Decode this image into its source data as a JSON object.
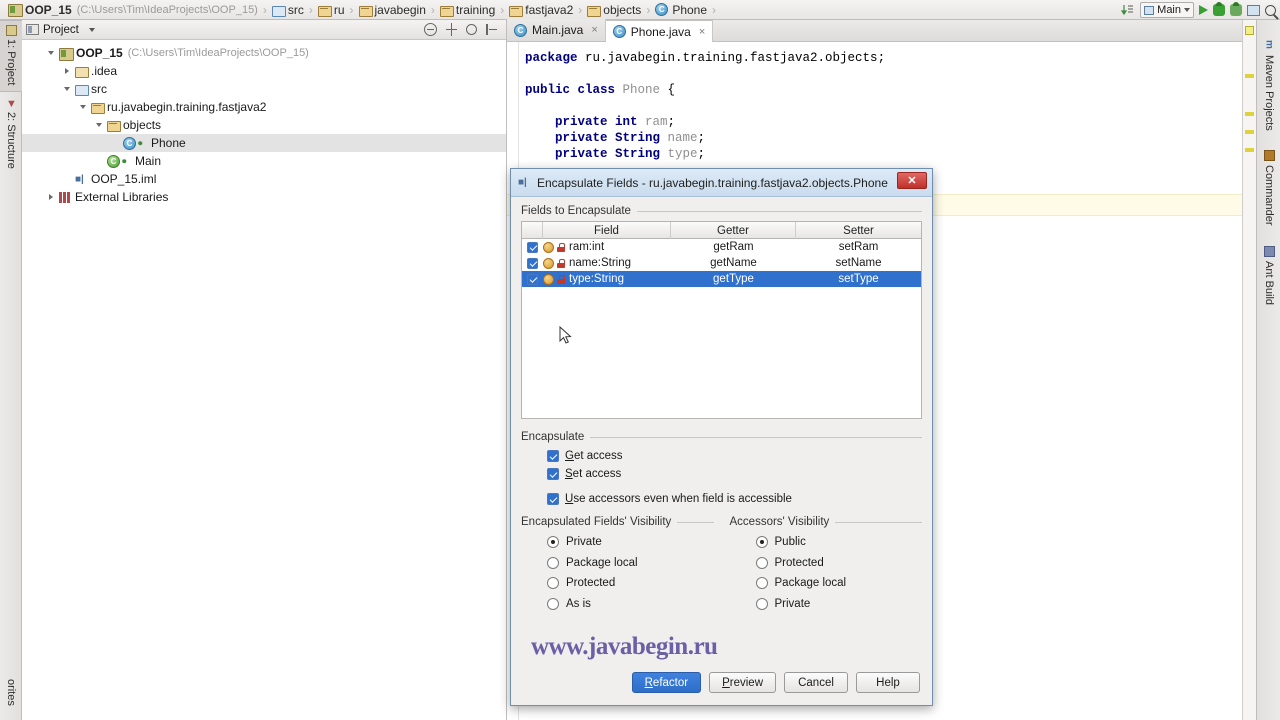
{
  "breadcrumb": {
    "items": [
      {
        "label": "OOP_15",
        "icon": "module-icon",
        "path": "(C:\\Users\\Tim\\IdeaProjects\\OOP_15)"
      },
      {
        "label": "src",
        "icon": "folder-blue-icon"
      },
      {
        "label": "ru",
        "icon": "package-icon"
      },
      {
        "label": "javabegin",
        "icon": "package-icon"
      },
      {
        "label": "training",
        "icon": "package-icon"
      },
      {
        "label": "fastjava2",
        "icon": "package-icon"
      },
      {
        "label": "objects",
        "icon": "package-icon"
      },
      {
        "label": "Phone",
        "icon": "class-icon"
      }
    ],
    "separator": "›"
  },
  "top_toolbar": {
    "run_config": "Main",
    "icons": [
      "update-project-icon",
      "run-icon",
      "debug-icon",
      "coverage-icon",
      "db-icon",
      "search-icon"
    ]
  },
  "left_tabs": [
    {
      "label": "1: Project",
      "icon": "project-icon",
      "active": true
    },
    {
      "label": "2: Structure",
      "icon": "structure-icon",
      "active": false
    },
    {
      "label": "orites",
      "icon": "favorites-icon",
      "active": false
    }
  ],
  "right_tabs": [
    {
      "label": "Maven Projects",
      "icon": "maven-icon"
    },
    {
      "label": "Commander",
      "icon": "commander-icon"
    },
    {
      "label": "Ant Build",
      "icon": "ant-icon"
    }
  ],
  "project_panel": {
    "title": "Project",
    "tools": [
      "collapse-all-icon",
      "scroll-from-source-icon",
      "settings-gear-icon",
      "hide-icon"
    ],
    "tree": [
      {
        "indent": 0,
        "twisty": "down",
        "icon": "module-icon",
        "label": "OOP_15",
        "bold": true,
        "path": "(C:\\Users\\Tim\\IdeaProjects\\OOP_15)",
        "selected": false
      },
      {
        "indent": 1,
        "twisty": "right",
        "icon": "folder-icon",
        "label": ".idea",
        "bold": false,
        "selected": false
      },
      {
        "indent": 1,
        "twisty": "down",
        "icon": "folder-blue-icon",
        "label": "src",
        "bold": false,
        "selected": false
      },
      {
        "indent": 2,
        "twisty": "down",
        "icon": "package-icon",
        "label": "ru.javabegin.training.fastjava2",
        "bold": false,
        "selected": false
      },
      {
        "indent": 3,
        "twisty": "down",
        "icon": "package-icon",
        "label": "objects",
        "bold": false,
        "selected": false
      },
      {
        "indent": 4,
        "twisty": "none",
        "icon": "class-icon",
        "label": "Phone",
        "bold": false,
        "selected": true
      },
      {
        "indent": 3,
        "twisty": "none",
        "icon": "class-runnable-icon",
        "label": "Main",
        "bold": false,
        "selected": false
      },
      {
        "indent": 1,
        "twisty": "none",
        "icon": "iml-icon",
        "label": "OOP_15.iml",
        "bold": false,
        "selected": false
      },
      {
        "indent": 0,
        "twisty": "right",
        "icon": "library-icon",
        "label": "External Libraries",
        "bold": false,
        "selected": false
      }
    ]
  },
  "editor": {
    "tabs": [
      {
        "label": "Main.java",
        "icon": "class-icon",
        "active": false,
        "close": "×"
      },
      {
        "label": "Phone.java",
        "icon": "class-icon",
        "active": true,
        "close": "×"
      }
    ],
    "code_lines": [
      [
        {
          "t": "package ",
          "c": "kw"
        },
        {
          "t": "ru.javabegin.training.fastjava2.objects;",
          "c": "pl"
        }
      ],
      [],
      [
        {
          "t": "public class ",
          "c": "kw"
        },
        {
          "t": "Phone",
          "c": "dim"
        },
        {
          "t": " {",
          "c": "pl"
        }
      ],
      [],
      [
        {
          "t": "    private int ",
          "c": "kw"
        },
        {
          "t": "ram",
          "c": "dim"
        },
        {
          "t": ";",
          "c": "pl"
        }
      ],
      [
        {
          "t": "    private ",
          "c": "kw"
        },
        {
          "t": "String ",
          "c": "kw"
        },
        {
          "t": "name",
          "c": "dim"
        },
        {
          "t": ";",
          "c": "pl"
        }
      ],
      [
        {
          "t": "    private ",
          "c": "kw"
        },
        {
          "t": "String ",
          "c": "kw"
        },
        {
          "t": "type",
          "c": "dim"
        },
        {
          "t": ";",
          "c": "pl"
        }
      ]
    ]
  },
  "dialog": {
    "title": "Encapsulate Fields - ru.javabegin.training.fastjava2.objects.Phone",
    "title_icon": "refactor-icon",
    "close_label": "✕",
    "fields_group_label": "Fields to Encapsulate",
    "table": {
      "columns": [
        "",
        "Field",
        "Getter",
        "Setter"
      ],
      "rows": [
        {
          "checked": true,
          "field": "ram:int",
          "getter": "getRam",
          "setter": "setRam",
          "selected": false
        },
        {
          "checked": true,
          "field": "name:String",
          "getter": "getName",
          "setter": "setName",
          "selected": false
        },
        {
          "checked": true,
          "field": "type:String",
          "getter": "getType",
          "setter": "setType",
          "selected": true
        }
      ]
    },
    "encapsulate_group_label": "Encapsulate",
    "encapsulate_options": [
      {
        "label": "Get access",
        "checked": true,
        "mnemonic": "G"
      },
      {
        "label": "Set access",
        "checked": true,
        "mnemonic": "S"
      },
      {
        "label": "Use accessors even when field is accessible",
        "checked": true,
        "mnemonic": "U"
      }
    ],
    "fields_visibility": {
      "label": "Encapsulated Fields' Visibility",
      "options": [
        {
          "label": "Private",
          "selected": true
        },
        {
          "label": "Package local",
          "selected": false
        },
        {
          "label": "Protected",
          "selected": false
        },
        {
          "label": "As is",
          "selected": false
        }
      ]
    },
    "accessors_visibility": {
      "label": "Accessors' Visibility",
      "options": [
        {
          "label": "Public",
          "selected": true
        },
        {
          "label": "Protected",
          "selected": false
        },
        {
          "label": "Package local",
          "selected": false
        },
        {
          "label": "Private",
          "selected": false
        }
      ]
    },
    "watermark": "www.javabegin.ru",
    "buttons": [
      {
        "label": "Refactor",
        "primary": true
      },
      {
        "label": "Preview",
        "primary": false
      },
      {
        "label": "Cancel",
        "primary": false
      },
      {
        "label": "Help",
        "primary": false
      }
    ]
  },
  "colors": {
    "accent": "#2f71cd",
    "selection": "#2f71cd",
    "close_button": "#c0302a",
    "watermark": "#6b5fa5",
    "marker": "#ddd23a"
  }
}
